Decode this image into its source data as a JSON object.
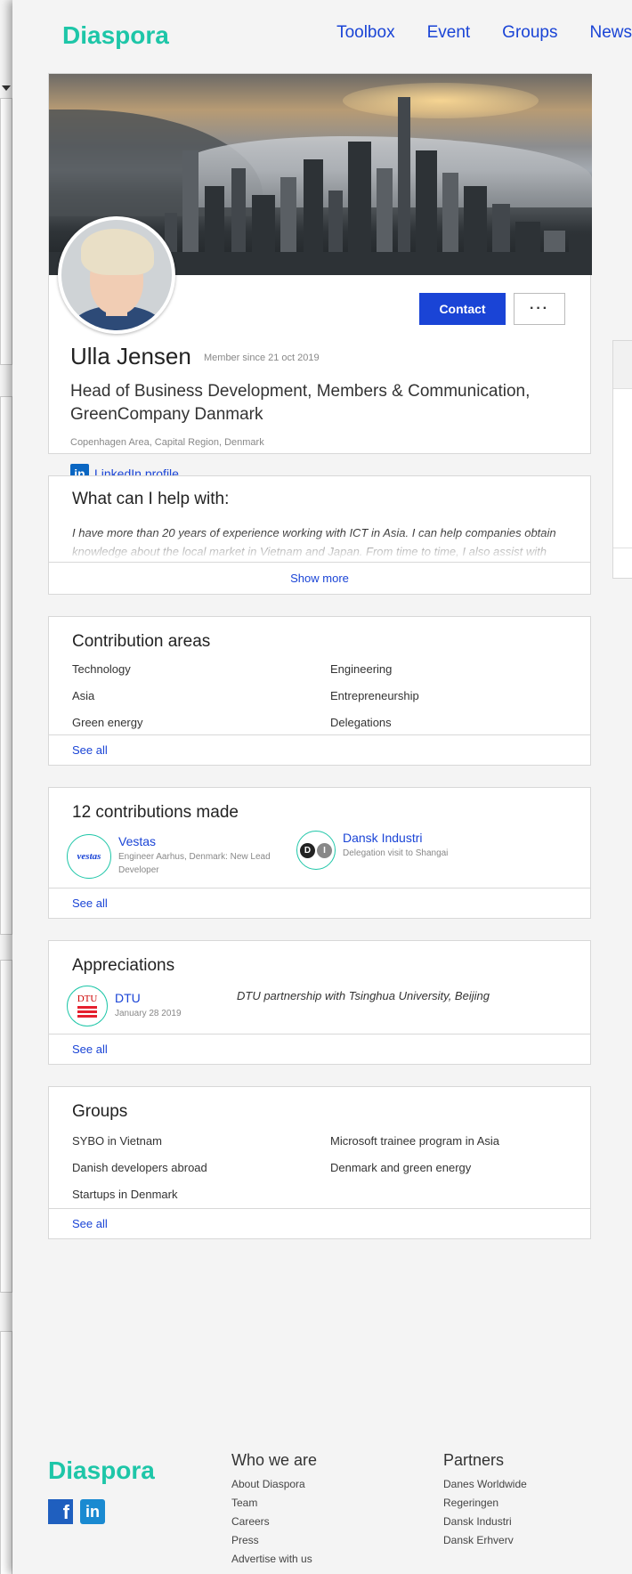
{
  "header": {
    "logo": "Diaspora",
    "nav": [
      "Toolbox",
      "Event",
      "Groups",
      "News"
    ]
  },
  "profile": {
    "name": "Ulla Jensen",
    "member_since": "Member since 21 oct 2019",
    "title": "Head of Business Development, Members & Communication, GreenCompany Danmark",
    "location": "Copenhagen Area, Capital Region, Denmark",
    "linkedin_label": "LinkedIn profile",
    "contact_label": "Contact",
    "more_label": "···"
  },
  "help": {
    "heading": "What can I help with:",
    "text": "I have more than 20 years of experience working with ICT in Asia. I can help companies obtain knowledge about the local market in Vietnam and Japan. From time to time, I also assist with delegation visits within my competence area. I",
    "show_more": "Show more"
  },
  "contribution_areas": {
    "heading": "Contribution areas",
    "items": [
      "Technology",
      "Engineering",
      "Asia",
      "Entrepreneurship",
      "Green energy",
      "Delegations"
    ],
    "see_all": "See all"
  },
  "contributions": {
    "heading": "12 contributions made",
    "items": [
      {
        "name": "Vestas",
        "detail": "Engineer Aarhus, Denmark: New Lead Developer",
        "logo_text": "vestas"
      },
      {
        "name": "Dansk Industri",
        "detail": "Delegation visit to Shangai",
        "logo_text": [
          "D",
          "I"
        ]
      }
    ],
    "see_all": "See all"
  },
  "appreciations": {
    "heading": "Appreciations",
    "item": {
      "name": "DTU",
      "date": "January 28 2019",
      "logo_text": "DTU",
      "quote": "DTU partnership with Tsinghua University, Beijing"
    },
    "see_all": "See all"
  },
  "groups": {
    "heading": "Groups",
    "items": [
      "SYBO in Vietnam",
      "Microsoft trainee program in Asia",
      "Danish developers abroad",
      "Denmark and green energy",
      "Startups in Denmark"
    ],
    "see_all": "See all"
  },
  "footer": {
    "logo": "Diaspora",
    "social": {
      "facebook": "f",
      "linkedin": "in"
    },
    "col1": {
      "heading": "Who we are",
      "links": [
        "About Diaspora",
        "Team",
        "Careers",
        "Press",
        "Advertise with us"
      ]
    },
    "col2": {
      "heading": "Partners",
      "links": [
        "Danes Worldwide",
        "Regeringen",
        "Dansk Industri",
        "Dansk Erhverv"
      ]
    }
  },
  "colors": {
    "accent": "#1a44d6",
    "brand": "#1ec6a8",
    "background": "#1c2a6e"
  }
}
